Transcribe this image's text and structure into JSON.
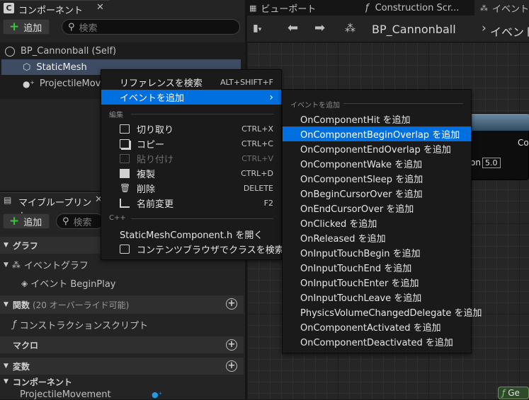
{
  "left_panel": {
    "tab_title": "コンポーネント",
    "add_label": "追加",
    "search_placeholder": "検索",
    "self_item": "BP_Cannonball (Self)",
    "items": [
      "StaticMesh",
      "ProjectileMovement"
    ]
  },
  "blueprint_panel": {
    "tab_title": "マイブループリント",
    "add_label": "追加",
    "search_placeholder": "検索",
    "sections": {
      "graph": "グラフ",
      "functions": "関数",
      "functions_note": "(20 オーバーライド可能)",
      "macros": "マクロ",
      "variables": "変数",
      "components": "コンポーネント"
    },
    "event_graph": "イベントグラフ",
    "begin_play": "イベント BeginPlay",
    "construction_script": "コンストラクションスクリプト",
    "component_var": "ProjectileMovement"
  },
  "tabs": {
    "viewport": "ビューポート",
    "construction": "Construction Scr...",
    "event": "イベント"
  },
  "graph_toolbar": {
    "breadcrumb": "BP_Cannonball",
    "breadcrumb_next": "イベント",
    "node_label": "Co",
    "pin_label": "on",
    "pin_value": "5.0",
    "bottom_node": "Ge"
  },
  "context_menu": {
    "top_items": [
      {
        "label": "リファレンスを検索",
        "shortcut": "ALT+SHIFT+F"
      },
      {
        "label": "イベントを追加",
        "shortcut": ">"
      }
    ],
    "edit_header": "編集",
    "edit_items": [
      {
        "label": "切り取り",
        "shortcut": "CTRL+X",
        "icon": "cut-icon",
        "disabled": false
      },
      {
        "label": "コピー",
        "shortcut": "CTRL+C",
        "icon": "copy-icon",
        "disabled": false
      },
      {
        "label": "貼り付け",
        "shortcut": "CTRL+V",
        "icon": "paste-icon",
        "disabled": true
      },
      {
        "label": "複製",
        "shortcut": "CTRL+D",
        "icon": "duplicate-icon",
        "disabled": false
      },
      {
        "label": "削除",
        "shortcut": "DELETE",
        "icon": "trash-icon",
        "disabled": false
      },
      {
        "label": "名前変更",
        "shortcut": "F2",
        "icon": "rename-icon",
        "disabled": false
      }
    ],
    "cpp_header": "C++",
    "cpp_items": [
      "StaticMeshComponent.h を開く",
      "コンテンツブラウザでクラスを検索"
    ]
  },
  "submenu": {
    "header": "イベントを追加",
    "items": [
      "OnComponentHit を追加",
      "OnComponentBeginOverlap を追加",
      "OnComponentEndOverlap を追加",
      "OnComponentWake を追加",
      "OnComponentSleep を追加",
      "OnBeginCursorOver を追加",
      "OnEndCursorOver を追加",
      "OnClicked を追加",
      "OnReleased を追加",
      "OnInputTouchBegin を追加",
      "OnInputTouchEnd を追加",
      "OnInputTouchEnter を追加",
      "OnInputTouchLeave を追加",
      "PhysicsVolumeChangedDelegate を追加",
      "OnComponentActivated を追加",
      "OnComponentDeactivated を追加"
    ],
    "selected_index": 1
  },
  "colors": {
    "selection": "#0070e0",
    "add_green": "#37c837"
  }
}
